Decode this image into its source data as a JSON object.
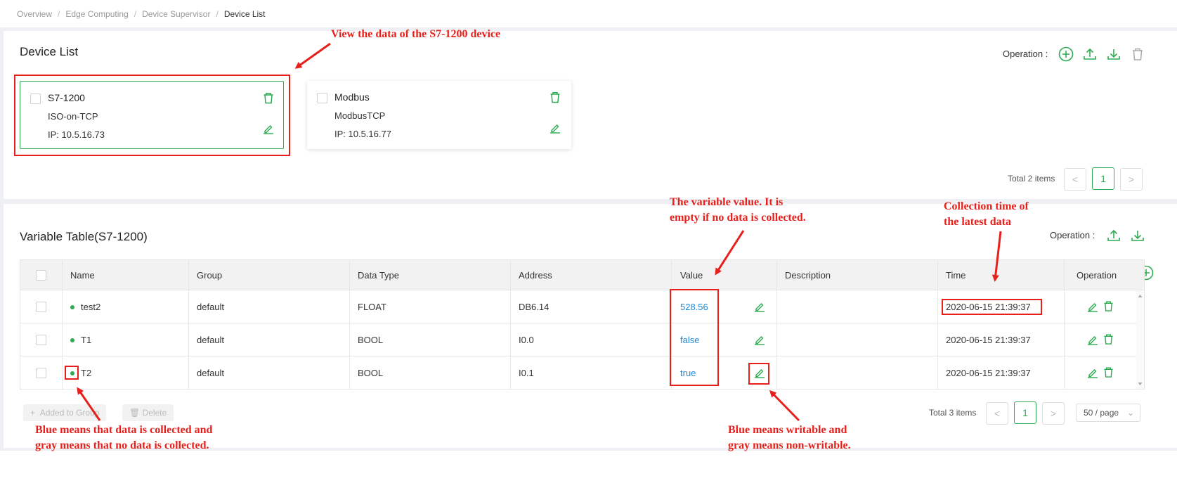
{
  "breadcrumb": [
    "Overview",
    "Edge Computing",
    "Device Supervisor",
    "Device List"
  ],
  "device_list": {
    "title": "Device List",
    "operation_label": "Operation :",
    "devices": [
      {
        "name": "S7-1200",
        "protocol": "ISO-on-TCP",
        "ip": "IP: 10.5.16.73",
        "selected": true
      },
      {
        "name": "Modbus",
        "protocol": "ModbusTCP",
        "ip": "IP: 10.5.16.77",
        "selected": false
      }
    ],
    "pagination": {
      "total": "Total 2 items",
      "current_page": "1",
      "prev": "<",
      "next": ">"
    }
  },
  "variable_table": {
    "title": "Variable Table(S7-1200)",
    "operation_label": "Operation :",
    "columns": [
      "Name",
      "Group",
      "Data Type",
      "Address",
      "Value",
      "Description",
      "Time",
      "Operation"
    ],
    "rows": [
      {
        "name": "test2",
        "group": "default",
        "data_type": "FLOAT",
        "address": "DB6.14",
        "value": "528.56",
        "description": "",
        "time": "2020-06-15 21:39:37"
      },
      {
        "name": "T1",
        "group": "default",
        "data_type": "BOOL",
        "address": "I0.0",
        "value": "false",
        "description": "",
        "time": "2020-06-15 21:39:37"
      },
      {
        "name": "T2",
        "group": "default",
        "data_type": "BOOL",
        "address": "I0.1",
        "value": "true",
        "description": "",
        "time": "2020-06-15 21:39:37"
      }
    ],
    "buttons": {
      "add_to_group": "Added to Group",
      "delete": "Delete"
    },
    "pagination": {
      "total": "Total 3 items",
      "current_page": "1",
      "prev": "<",
      "next": ">",
      "page_size": "50 / page"
    }
  },
  "annotations": {
    "device": "View the data of the S7-1200 device",
    "value_line1": "The variable value. It is",
    "value_line2": "empty if no data is collected.",
    "time_line1": "Collection time of",
    "time_line2": "the latest data",
    "dot_line1": "Blue means that data is collected and",
    "dot_line2": "gray means that no data is collected.",
    "write_line1": "Blue means writable and",
    "write_line2": "gray means non-writable."
  },
  "colors": {
    "accent": "#2eab52",
    "value_blue": "#1e88d6",
    "annotation_red": "#e8201b"
  }
}
